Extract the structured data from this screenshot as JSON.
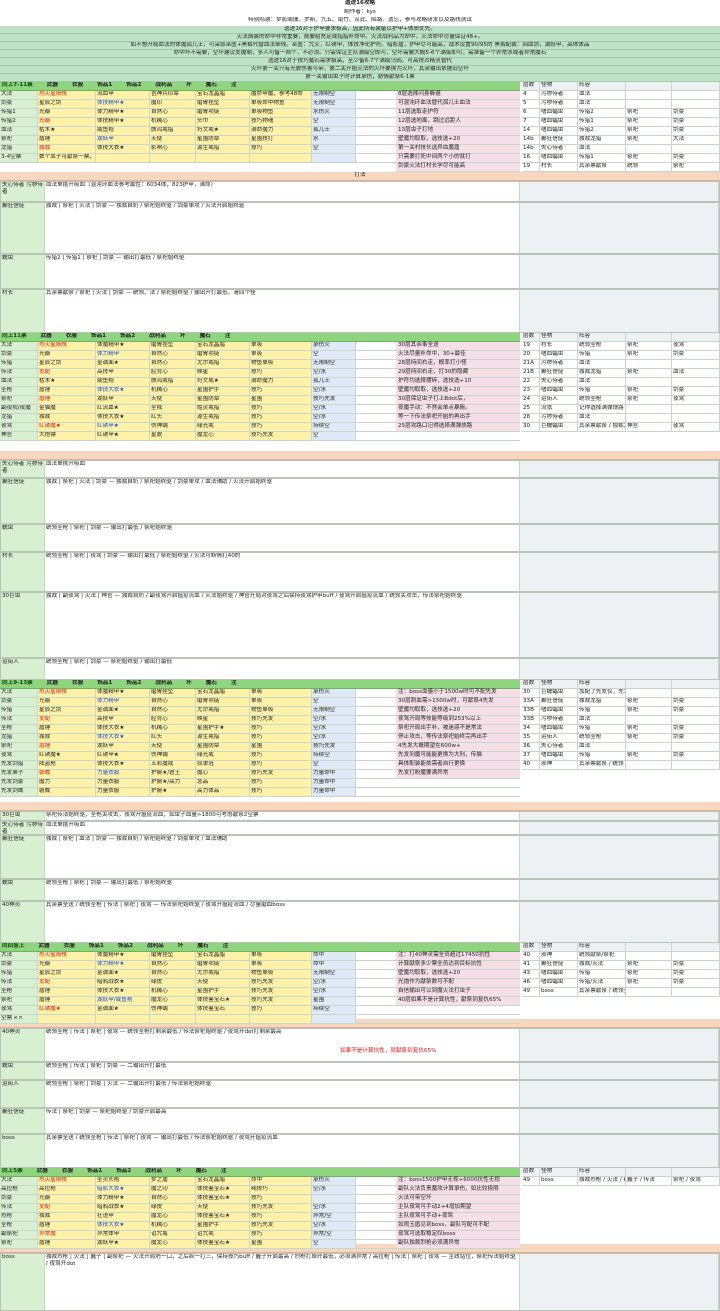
{
  "header": {
    "title": "遗迹16攻略",
    "author": "制作者：kys",
    "thanks": "特别鸣谢：梦影阑珊、罗斯、九五、南竹、从此、陌路、遗忘，参与攻略研发以及路线测试"
  },
  "intro": [
    "遗迹16对于护甲要求极高，因此所有装备以护甲+体质优先。",
    "火法厕装的命中非常重要，厕要给充足戒指指补命中。火法战利品为命中，火法命中尽量保证48+。",
    "如不想开局血法的体魔孤儿士，可采取巫医+黑裤代替血法牵线。巫医：咒火，红锈甲，体技净化护符。暗影盾，护甲尽可能高，战术设置90/95的  黑裤配装：回血剑，湖妖甲，高体体品",
    "命中坏不需要，空坏建议支援制，多人可备一两个，不必须。只需保证主队满级空即可，空坏需要大概5-6个满级即可，需准备一个异常水或者异常魔石",
    "遗迹16对于技巧魔石需求极高，至少备6-7个满级乌鸦，可高技占精灵替代",
    "火坏第一关只有光貌伤害可带，第二关开始火法的火坏要换为火坏，其余输出依据旧空坏",
    "第一关输出虫子时计算承伤，胁情献祭6-1票"
  ],
  "sections": [
    {
      "title": "同上7-11票",
      "headers": [
        "武器",
        "衣服",
        "饰品1",
        "饰品2",
        "战利品",
        "坏",
        "魔石",
        "注"
      ],
      "rows": [
        [
          "大法",
          "烈火星陨枝",
          "流血甲",
          "吉神兵印章",
          "宝石龙晶脂",
          "魔命甲魔，参考48命",
          "无限制空",
          "龙栗妖"
        ],
        [
          "剑豪",
          "星辰之剑",
          "体技精甲★",
          "魔印",
          "磨胃挂坠",
          "单吸命中物鱼",
          "无限制空",
          "暴君"
        ],
        [
          "传猎1",
          "光瓣",
          "体力精甲★",
          "自然心",
          "磨胃项链",
          "单吸物鱼",
          "水伤火",
          "星界石"
        ],
        [
          "传猎2",
          "光瓣",
          "体技精甲★",
          "机械心",
          "头巾",
          "技巧物魂",
          "空",
          "乌鸦"
        ],
        [
          "血法",
          "枯木★",
          "咸鱼袍",
          "骸鸿戒指",
          "符文戒★",
          "满命魔力",
          "孤儿士",
          "高体体精灵"
        ],
        [
          "祭祀",
          "盾锤",
          "湖妖甲",
          "天使",
          "星围防章",
          "星围技打",
          "水",
          "乌鸦"
        ],
        [
          "龙猎",
          "独裁",
          "体技大衣★",
          "影响心",
          "源生戒指",
          "技巧",
          "空",
          "乌鸦"
        ],
        [
          "3-4空票",
          "数个虫子可献祭一票，火法打村长存在生存压力，可多配一票空票献祭村长",
          "",
          "",
          "",
          "",
          "",
          ""
        ]
      ],
      "notes": [
        "8层选择闪身躲避",
        "可混沌环血法替代孤儿士血法",
        "11层选取走护符",
        "12层选地离，跳过远距人",
        "13层虫子打地",
        "壁魔均取取，选技选+20",
        "第一关村技长选异血魔盾",
        "只需要打死中间两个小的就打",
        "剑豪火法打村长学尽可能高"
      ],
      "floors": [
        [
          "层数",
          "怪物",
          "阵容",
          "",
          ""
        ],
        [
          "4",
          "污秽侍者",
          "血法",
          "",
          ""
        ],
        [
          "5",
          "污秽侍者",
          "血法",
          "",
          ""
        ],
        [
          "6",
          "嗜血蝠虫",
          "传猎2",
          "祭祀",
          "剑豪"
        ],
        [
          "7",
          "嗜血蝠虫",
          "传猎1",
          "祭祀",
          "剑豪"
        ],
        [
          "14",
          "嗜血蝠虫",
          "传猎2",
          "祭祀",
          "剑豪"
        ],
        [
          "14b",
          "癫狂信徒",
          "独裁龙猎",
          "祭祀",
          "大法"
        ],
        [
          "14b",
          "失心侍者",
          "血法",
          "",
          ""
        ],
        [
          "16",
          "嗜血蝠虫",
          "传猎1",
          "祭祀",
          "剑豪"
        ],
        [
          "19",
          "村长",
          "其余票献祭",
          "统领",
          "祭祀"
        ]
      ]
    }
  ],
  "legend": {
    "divider1": "打法",
    "bosses1": [
      {
        "name": "失心侍者 污秽侍者",
        "text": "血法单挑开吸血（混沌环血法参考属性：6034体，823护甲，满命）"
      },
      {
        "name": "癫狂信徒",
        "text": "独裁 | 祭祀 | 火法 | 剑豪 — 独裁自奶 / 祭祀始终驱 / 剑豪单攻 / 火法开启始终驱"
      },
      {
        "name": "蠕虫",
        "text": "传猎2 | 传猎1 | 祭祀 | 剑豪 — 输出打最低 / 祭祀始终驱"
      },
      {
        "name": "村长",
        "text": "其余票献祭 / 祭祀 | 火法 | 剑豪 — 统领、法 / 祭祀始终驱 / 输出开打最低，清四个怪"
      }
    ]
  },
  "sec2": {
    "title": "同上11票",
    "headers": [
      "武器",
      "衣服",
      "饰品1",
      "饰品2",
      "战利品",
      "坏",
      "魔石",
      "注"
    ],
    "rows": [
      [
        "大法",
        "烈火星陨枝",
        "体魔精甲★",
        "磨胃挂坠",
        "宝石龙晶脂",
        "单吸",
        "承伤火",
        "15命古精灵"
      ],
      [
        "剑豪",
        "光瓣",
        "体力精甲",
        "自然心",
        "磨胃项链",
        "单吸",
        "空",
        "星界石"
      ],
      [
        "传猎",
        "星辰之剑",
        "金诚面★",
        "自然心",
        "尤尔戒指",
        "物鱼单吸",
        "无限制空",
        "暴君"
      ],
      [
        "传法",
        "支配",
        "高技甲",
        "腔背心",
        "映星",
        "技巧",
        "空/水",
        "巧乎乌鸦"
      ],
      [
        "血法",
        "枯木★",
        "咸鱼袍",
        "骸鸿戒指",
        "符文戒★",
        "满命魔力",
        "孤儿士",
        "15命古精灵"
      ],
      [
        "圣枪",
        "盾锤",
        "体技大衣★",
        "机械心",
        "星围护手",
        "技巧",
        "空/水",
        "乌鸦"
      ],
      [
        "祭祀",
        "盾锤",
        "湖妖甲",
        "天使",
        "星围防章",
        "星围",
        "技巧先发",
        "空/水",
        "乌鸦"
      ],
      [
        "副夜视/夜魔",
        "金猫魔",
        "红流血★",
        "圣戒",
        "骷灵戒指",
        "技巧",
        "空/水",
        "乌鸦"
      ],
      [
        "龙猎",
        "独裁",
        "体技大衣★",
        "红头",
        "源生戒指",
        "技巧",
        "空/水",
        "乌鸦"
      ],
      [
        "夜驾",
        "红锈魔★",
        "红锈甲★",
        "伤神端",
        "绿光戒",
        "技巧",
        "持续空",
        "乌鸦"
      ],
      [
        "神官",
        "大捂镖",
        "红锈甲★",
        "星貌",
        "魔龙心",
        "技巧先发",
        "空",
        "乌鸦/古精灵"
      ]
    ],
    "notes": [
      "30层其余事全送",
      "火法尽量补命中，30+最佳",
      "28层持间右走，概率打小怪",
      "29层持间右走，打30的隐藏",
      "护符均选择摆碎，选技选+10",
      "壁魔均取取，选技选+20",
      "30层保证虫子打上Bdot后，",
      "夜魔手动：不然会单点暴毙。",
      "等一下传法祭祀开始的再出手",
      "25层攻路口记得选择满弹烧路"
    ],
    "floors": [
      [
        "层数",
        "怪物",
        "阵容",
        "",
        ""
      ],
      [
        "19",
        "村长",
        "统领圣枪",
        "祭祀",
        "夜驾"
      ],
      [
        "20",
        "嗜血蝠虫",
        "传猎",
        "祭祀",
        "剑豪"
      ],
      [
        "21A",
        "污秽侍者",
        "血法",
        "",
        ""
      ],
      [
        "21B",
        "癫狂信徒",
        "独裁龙猎",
        "祭祀",
        "血法"
      ],
      [
        "22",
        "失心侍者",
        "血法",
        "",
        ""
      ],
      [
        "23",
        "嗜血蝠虫",
        "传猎",
        "祭祀",
        "剑豪"
      ],
      [
        "24",
        "运街人",
        "统领圣枪",
        "祭祀",
        "夜驾"
      ],
      [
        "25",
        "流弦",
        "记得选择满弹烧路",
        "",
        ""
      ],
      [
        "28",
        "污秽侍者",
        "血法",
        "",
        ""
      ],
      [
        "30",
        "巨蠕蝠虫",
        "其余票献祭 / 独裁龙猎 / 统领圣枪",
        "神官",
        "夜驾"
      ]
    ]
  },
  "divider2": "打法",
  "tactics2": [
    {
      "name": "失心侍者 污秽侍者",
      "text": "血法单挑开吸血"
    },
    {
      "name": "癫狂信徒",
      "text": "独裁 | 祭祀 | 火法 | 剑豪 — 独裁自奶 / 祭祀始终驱 / 剑豪单攻 / 血法辅助 / 火法开启始终驱"
    },
    {
      "name": "蠕虫",
      "text": "统领圣枪 | 祭祀 | 剑豪 — 输出打最低 / 祭祀始终驱"
    },
    {
      "name": "村长",
      "text": "统领圣枪 | 祭祀 | 夜驾 | 剑豪 — 输出打最低 / 祭祀始终驱 / 火法可断情打40的"
    },
    {
      "name": "30巨虫",
      "text": "独裁 | 副夜驾 | 火法 | 神官 — 独裁自奶 / 副夜驾开启瘟疫流血 / 火法始终驱 / 神官开局对夜驾之后保持夜驾护甲buff / 夜驾开启瘟疫流血 / 统领关攻击，传法祭祀始终驱"
    },
    {
      "name": "运街人",
      "text": "统领圣枪 | 祭祀 | 剑豪 — 祭祀始终驱 / 输出打最低"
    }
  ],
  "sec3": {
    "title": "同上9-13票",
    "headers": [
      "武器",
      "衣服",
      "饰品1",
      "饰品2",
      "战利品",
      "坏",
      "魔石",
      "注"
    ],
    "rows": [
      [
        "大法",
        "烈火星陨枝",
        "体魔精甲★",
        "磨胃挂坠",
        "宝石龙晶脂",
        "单吸",
        "承伤火",
        "15命古精灵"
      ],
      [
        "剑豪",
        "光瓣",
        "体力精甲",
        "自然心",
        "磨胃项链",
        "单吸",
        "空",
        "星界石"
      ],
      [
        "传猎",
        "星辰之剑",
        "金诚面★",
        "自然心",
        "尤尔戒指",
        "物鱼单吸",
        "无限制空",
        "暴君"
      ],
      [
        "传法",
        "支配",
        "高技甲",
        "腔背心",
        "映星",
        "技巧先发",
        "空/水",
        "巧乎乌鸦"
      ],
      [
        "圣枪",
        "盾锤",
        "体技大衣★",
        "机械心",
        "星围护手★",
        "技巧",
        "空/水",
        "乌鸦"
      ],
      [
        "龙猎",
        "独裁",
        "体技大衣★",
        "红头",
        "源生戒指",
        "技巧",
        "空/水",
        "乌鸦"
      ],
      [
        "祭祀",
        "盾锤",
        "湖妖甲",
        "天使",
        "星围防章",
        "星围",
        "技巧先发",
        "空/水",
        "乌鸦"
      ],
      [
        "夜驾",
        "红锈魔★",
        "红锈甲★",
        "伤神端",
        "绿光戒",
        "技巧",
        "持续空",
        "乌鸦"
      ],
      [
        "先发剑猎",
        "陆盗枪",
        "体技大衣★",
        "五彩魔戒",
        "奴隶冠",
        "技巧",
        "空",
        "乌鸦"
      ],
      [
        "先发弟子",
        "磐威",
        "力量衣服",
        "护腕★/君王",
        "魔心",
        "技巧先发",
        "力量命中",
        "火/空",
        "乌鸦"
      ],
      [
        "先发剑豪",
        "魔力",
        "力量衣服",
        "护腕★/高力",
        "急品",
        "技巧",
        "力量命中",
        "火/空",
        "乌鸦"
      ],
      [
        "先发剑鹰",
        "磐威",
        "力量衣服",
        "护腕★",
        "高力体品",
        "技巧",
        "力量命中",
        "火/空",
        "乌鸦"
      ]
    ],
    "notes": [
      "注：boss血量小于1500w时可不配先发",
      "30层刺血需>1500w时，可献祭4先发",
      "壁魔均取取，选技选+20",
      "夜驾开局等技能等级到253%以上",
      "祭祀开局出手补，被迷惑不是常法",
      "停止攻击，等传法祭祀始终完再出手",
      "4先发大概期望在600w+",
      "先发到魔可能能更换为大刑，传猫",
      "具体配装能依需者自行更换",
      "先发打粉魔要满异常"
    ],
    "floors": [
      [
        "层数",
        "怪物",
        "阵容",
        "",
        ""
      ],
      [
        "30",
        "巨蠕蝠虫",
        "加配了先发仅，先发仅先献祭",
        "",
        ""
      ],
      [
        "33A",
        "癫狂信徒",
        "独裁龙猎",
        "祭祀",
        "剑豪"
      ],
      [
        "33B",
        "嗜血蝠虫",
        "传猎",
        "祭祀",
        "剑豪"
      ],
      [
        "33B",
        "污秽侍者",
        "血法",
        "",
        ""
      ],
      [
        "34",
        "嗜血蝠虫",
        "传猎",
        "祭祀",
        "剑豪"
      ],
      [
        "35",
        "运街人",
        "统领圣枪",
        "祭祀",
        "剑豪"
      ],
      [
        "36",
        "失心侍者",
        "血法",
        "",
        ""
      ],
      [
        "37",
        "嗜血蝠虫",
        "传猎",
        "祭祀",
        "剑豪"
      ],
      [
        "40",
        "邪神",
        "其余票献祭 / 统领 | 祭祀 | 夜驾",
        "",
        ""
      ]
    ]
  },
  "divider3": "打法",
  "tactics3": [
    {
      "name": "30巨虫",
      "text": "祭祀传法始终驱，圣枪关攻击，夜驾开瘟疫流血，如虫子血量>1800可考虑献祭2空票"
    },
    {
      "name": "失心侍者 污秽侍者",
      "text": "血法单挑开吸血"
    },
    {
      "name": "癫狂信徒",
      "text": "独裁 | 祭祀 | 血法 | 剑豪 — 独裁自奶 / 祭祀始终驱 / 剑豪单攻 / 血法辅助"
    },
    {
      "name": "蠕虫",
      "text": "统领圣枪 | 祭祀 | 剑豪 — 输出打最低 / 祭祀始终驱"
    },
    {
      "name": "40神灵",
      "text": "其余票全送 / 统领圣枪 | 传法 | 祭祀 | 夜驾 — 传法祭祀始终驱 / 夜驾开瘟疫流血 / 尽量磨血boss"
    }
  ],
  "sec4": {
    "title": "同四金上",
    "headers": [
      "武器",
      "衣服",
      "饰品1",
      "饰品2",
      "战利品",
      "坏",
      "魔石",
      "注"
    ],
    "rows": [
      [
        "大法",
        "烈火星陨枝",
        "体魔精甲★",
        "磨胃挂坠",
        "宝石龙晶脂",
        "单吸",
        "命中",
        "承伤火",
        "15命古精灵"
      ],
      [
        "剑豪",
        "光瓣",
        "体力精甲★",
        "自然心",
        "磨胃项链",
        "单吸",
        "命中",
        "空",
        "星界石"
      ],
      [
        "传猎",
        "星辰之剑",
        "金诚面★",
        "自然心",
        "尤尔戒指",
        "物鱼单吸",
        "无限制空",
        "暴君"
      ],
      [
        "传法",
        "支配",
        "暗鸦战衣★",
        "绿皮",
        "天使",
        "技巧先发",
        "空/水",
        "巧乎乌鸦"
      ],
      [
        "圣枪",
        "盾锤",
        "体技大衣★",
        "机械心",
        "星围护手",
        "技巧先发",
        "空/水",
        "乌鸦"
      ],
      [
        "祭祀",
        "盾锤",
        "湖妖甲/咸鱼袍",
        "魔龙心",
        "体技鉴宝石★",
        "技巧先发",
        "星围",
        "空",
        "乌鸦"
      ],
      [
        "夜驾",
        "红锈魔★",
        "金诚面★",
        "伤神端",
        "体技鉴宝石",
        "技巧",
        "持续空",
        "乌鸦"
      ],
      [
        "空票 x n",
        "",
        "",
        "",
        "",
        "",
        "",
        ""
      ]
    ],
    "notes": [
      "注：打40神灵需全员超过17450抗性",
      "计算献祭多少票全员达到目标抗性",
      "壁魔均取取，选技选+20",
      "光炮作为献祭数可不配",
      "自信输出可以到魔火法打虫子",
      "40层如果不是计算抗性，献祭到复仇65%"
    ],
    "floors": [
      [
        "层数",
        "怪物",
        "阵容",
        "",
        ""
      ],
      [
        "40",
        "邪神",
        "统领献祭/祭祀",
        "",
        ""
      ],
      [
        "41",
        "癫狂信徒",
        "独裁/火法",
        "祭祀",
        "剑豪"
      ],
      [
        "43",
        "嗜血蝠虫",
        "传猎",
        "祭祀",
        "剑豪"
      ],
      [
        "46",
        "嗜血蝠虫",
        "传猎/火法",
        "祭祀",
        "剑豪"
      ],
      [
        "49",
        "boss",
        "其余票献祭 / 统领圣枪 / 夜驾",
        "",
        ""
      ]
    ]
  },
  "divider4": "打法",
  "tactics4": [
    {
      "name": "40神灵",
      "text": "统领圣枪 | 传法 | 祭祀 | 夜驾 — 统领圣枪打剩余最低 / 传法祭祀始终驱 / 夜驾开dot打剩余最高"
    },
    {
      "name": "蠕虫",
      "text": "统领圣枪 | 传法 | 祭祀 | 剑豪 — 二输出开打最低"
    },
    {
      "name": "运街人",
      "text": "统领圣枪 | 祭祀 | 剑豪 | 火法 — 二输出开打最低 / 传法祭祀始终驱"
    },
    {
      "name": "癫狂信徒",
      "text": "传法 | 祭祀 | 剑豪 — 祭祀始终驱 / 剑豪开启最高"
    },
    {
      "name": "boss",
      "text": "其余票全送 / 统领圣枪 | 传法 | 祭祀 | 夜驾 — 输出打最低 / 传法祭祀始终驱 / 夜驾开瘟疫流血"
    }
  ],
  "warning4": "如果不是计算抗性，就献祭到复仇65%",
  "sec5": {
    "title": "同上5票",
    "headers": [
      "武器",
      "衣服",
      "饰品1",
      "饰品2",
      "战利品",
      "坏",
      "魔石",
      "注"
    ],
    "rows": [
      [
        "大法",
        "烈火星陨枝",
        "圣灵长袍",
        "梦之盾",
        "宝石龙晶脂",
        "命中",
        "承伤火",
        "15命古精灵"
      ],
      [
        "高拉枪",
        "高拉枪",
        "暗影大衣★",
        "魔之印",
        "体技鉴宝石★",
        "纯技巧",
        "空/水",
        "乌鸦"
      ],
      [
        "剑豪",
        "光瓣",
        "体力精甲★",
        "自然心",
        "体技鉴宝石★",
        "技巧",
        "",
        "高体技"
      ],
      [
        "传法",
        "支配",
        "暗鸦战衣★",
        "绿皮",
        "天使",
        "技巧先发",
        "空/水",
        "巧乎乌鸦"
      ],
      [
        "烈枪",
        "独裁",
        "狂语甲",
        "魔龙心",
        "体技鉴宝石★",
        "技巧",
        "异常/空",
        "异常乌鸦"
      ],
      [
        "圣枪",
        "盾锤",
        "体技大衣★",
        "机械心",
        "星围护手",
        "技巧先发",
        "空/水",
        "乌鸦"
      ],
      [
        "副祭祀",
        "异常魔",
        "异常体甲",
        "诅咒瓶",
        "诅咒戒",
        "技巧",
        "异常/空",
        "异常乌鸦"
      ],
      [
        "祭祀",
        "盾锤",
        "湖妖甲★",
        "魔龙心",
        "体技鉴宝石★",
        "星围",
        "空",
        "乌鸦"
      ]
    ],
    "notes": [
      "注：boss1500护甲无视+6000抗性无视",
      "副队火法负责魔攻计算承伤，如比较极限",
      "火法可带空坏",
      "主队夜驾可手动2+4增加期望",
      "主队夜驾可手动+夜驾",
      "如闹玉盾见到boss，副队可配可不配",
      "夜驾可选取稳定叹boss",
      "副队独裁烈枪必须满异常"
    ],
    "floors": [
      [
        "层数",
        "怪物",
        "阵容",
        "",
        ""
      ],
      [
        "49",
        "boss",
        "独裁烈枪 / 火法 / 统领圣枪",
        "蠢子 / 传法",
        "祭祀 / 夜驾"
      ]
    ]
  },
  "divider5": "打法",
  "tactics5": [
    {
      "name": "boss",
      "text": "独裁烈枪 | 火法 | 蠢子 | 副祭祀 — 火法开局坍一口，之后疯一打三，保持技巧buff / 蠢子开启最高 / 烈枪打掉开最低，必须满异常 / 高拉枪 | 传法 | 祭祀 | 夜驾 — 主政站位，祭祀传法始终驱 / 夜驾开dot"
    }
  ],
  "colors": {
    "header_bar": "#8fd47f",
    "yellow": "#fff2a8",
    "green_bg": "#d9efd2",
    "red_text": "#d31919",
    "blue_text": "#1c4fd1",
    "divider": "#f8d7c0"
  }
}
